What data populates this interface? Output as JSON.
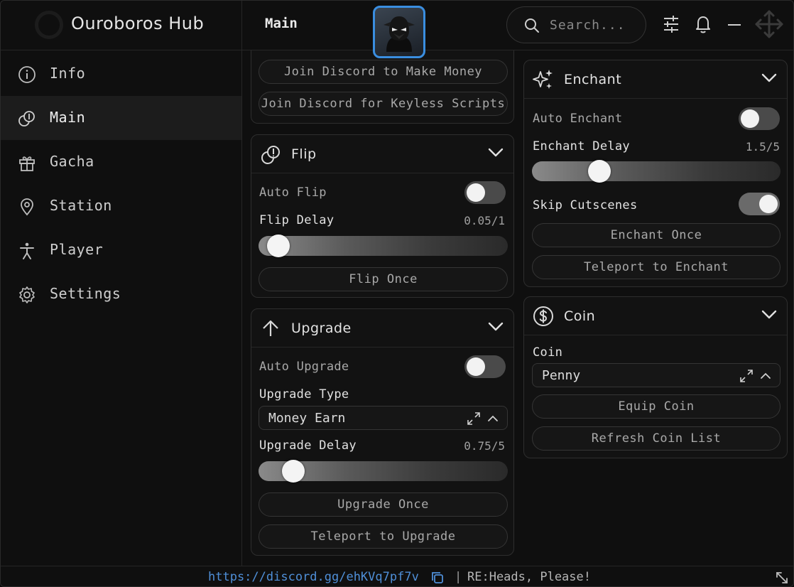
{
  "app": {
    "title": "Ouroboros Hub",
    "page_title": "Main",
    "accent_color": "#3a8ee0"
  },
  "search": {
    "placeholder": "Search..."
  },
  "sidebar": {
    "items": [
      {
        "label": "Info",
        "icon": "info-icon"
      },
      {
        "label": "Main",
        "icon": "coins-icon",
        "active": true
      },
      {
        "label": "Gacha",
        "icon": "gift-icon"
      },
      {
        "label": "Station",
        "icon": "map-pin-icon"
      },
      {
        "label": "Player",
        "icon": "person-icon"
      },
      {
        "label": "Settings",
        "icon": "gear-icon"
      }
    ]
  },
  "discord_card": {
    "buttons": [
      "Join Discord to Make Money",
      "Join Discord for Keyless Scripts"
    ]
  },
  "flip": {
    "title": "Flip",
    "auto_label": "Auto Flip",
    "auto_on": false,
    "delay_label": "Flip Delay",
    "delay_value": "0.05/1",
    "delay_fraction": 0.05,
    "button": "Flip Once"
  },
  "upgrade": {
    "title": "Upgrade",
    "auto_label": "Auto Upgrade",
    "auto_on": false,
    "type_label": "Upgrade Type",
    "type_value": "Money Earn",
    "delay_label": "Upgrade Delay",
    "delay_value": "0.75/5",
    "delay_fraction": 0.15,
    "buttons": [
      "Upgrade Once",
      "Teleport to Upgrade"
    ]
  },
  "enchant": {
    "title": "Enchant",
    "auto_label": "Auto Enchant",
    "auto_on": false,
    "delay_label": "Enchant Delay",
    "delay_value": "1.5/5",
    "delay_fraction": 0.3,
    "skip_label": "Skip Cutscenes",
    "skip_on": true,
    "buttons": [
      "Enchant Once",
      "Teleport to Enchant"
    ]
  },
  "coin": {
    "title": "Coin",
    "select_label": "Coin",
    "select_value": "Penny",
    "buttons": [
      "Equip Coin",
      "Refresh Coin List"
    ]
  },
  "footer": {
    "link": "https://discord.gg/ehKVq7pf7v",
    "separator": "|",
    "status": "RE:Heads, Please!"
  }
}
